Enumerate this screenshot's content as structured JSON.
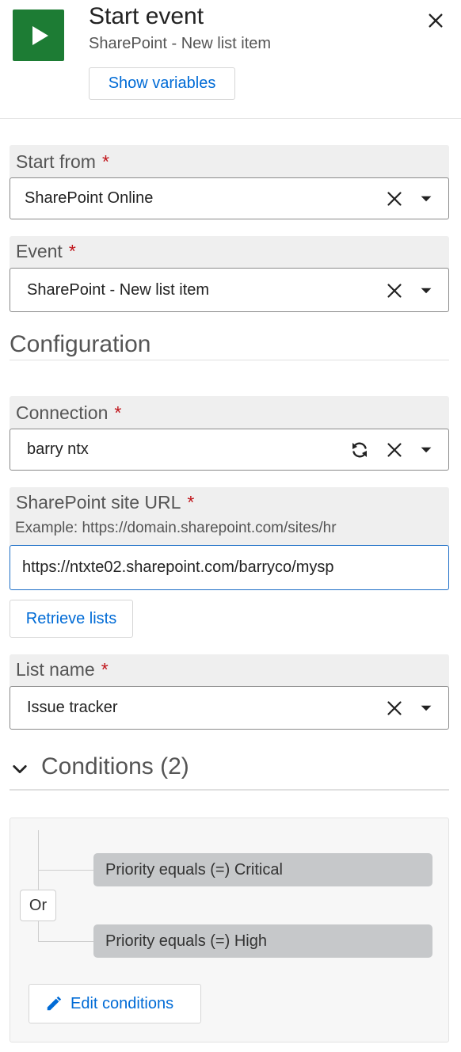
{
  "header": {
    "title": "Start event",
    "subtitle": "SharePoint - New list item",
    "show_variables_label": "Show variables",
    "accent_color": "#1d7c34"
  },
  "fields": {
    "start_from": {
      "label": "Start from",
      "required_mark": "*",
      "value": "SharePoint Online"
    },
    "event": {
      "label": "Event",
      "required_mark": "*",
      "value": "SharePoint - New list item"
    }
  },
  "configuration": {
    "title": "Configuration",
    "connection": {
      "label": "Connection",
      "required_mark": "*",
      "value": "barry ntx"
    },
    "site_url": {
      "label": "SharePoint site URL",
      "required_mark": "*",
      "hint": "Example: https://domain.sharepoint.com/sites/hr",
      "value": "https://ntxte02.sharepoint.com/barryco/mysp"
    },
    "retrieve_lists_label": "Retrieve lists",
    "list_name": {
      "label": "List name",
      "required_mark": "*",
      "value": "Issue tracker"
    }
  },
  "conditions": {
    "title": "Conditions (2)",
    "operator": "Or",
    "items": [
      "Priority equals (=) Critical",
      "Priority equals (=) High"
    ],
    "edit_label": "Edit conditions"
  },
  "icons": {
    "start": "play-icon",
    "close": "close-icon",
    "clear": "clear-icon",
    "dropdown": "caret-down-icon",
    "refresh": "refresh-icon",
    "collapse": "chevron-down-icon",
    "edit": "pencil-icon"
  },
  "colors": {
    "link": "#006bd6",
    "required": "#c0151b",
    "focus_border": "#1e6fc7"
  }
}
